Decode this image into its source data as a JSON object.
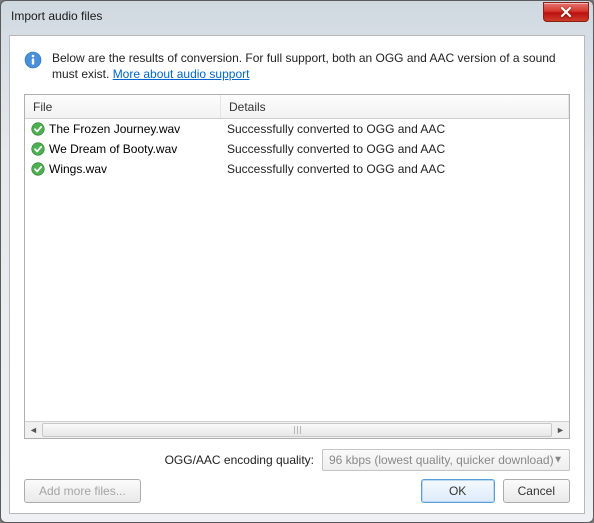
{
  "window": {
    "title": "Import audio files"
  },
  "info": {
    "text_main": "Below are the results of conversion.  For full support, both an OGG and AAC version of a sound must exist.  ",
    "link": "More about audio support"
  },
  "table": {
    "headers": {
      "file": "File",
      "details": "Details"
    },
    "rows": [
      {
        "file": "The Frozen Journey.wav",
        "details": "Successfully converted to OGG and AAC",
        "status": "success"
      },
      {
        "file": "We Dream of Booty.wav",
        "details": "Successfully converted to OGG and AAC",
        "status": "success"
      },
      {
        "file": "Wings.wav",
        "details": "Successfully converted to OGG and AAC",
        "status": "success"
      }
    ]
  },
  "quality": {
    "label": "OGG/AAC encoding quality:",
    "value": "96 kbps (lowest quality, quicker download)"
  },
  "buttons": {
    "add_more": "Add more files...",
    "ok": "OK",
    "cancel": "Cancel"
  }
}
